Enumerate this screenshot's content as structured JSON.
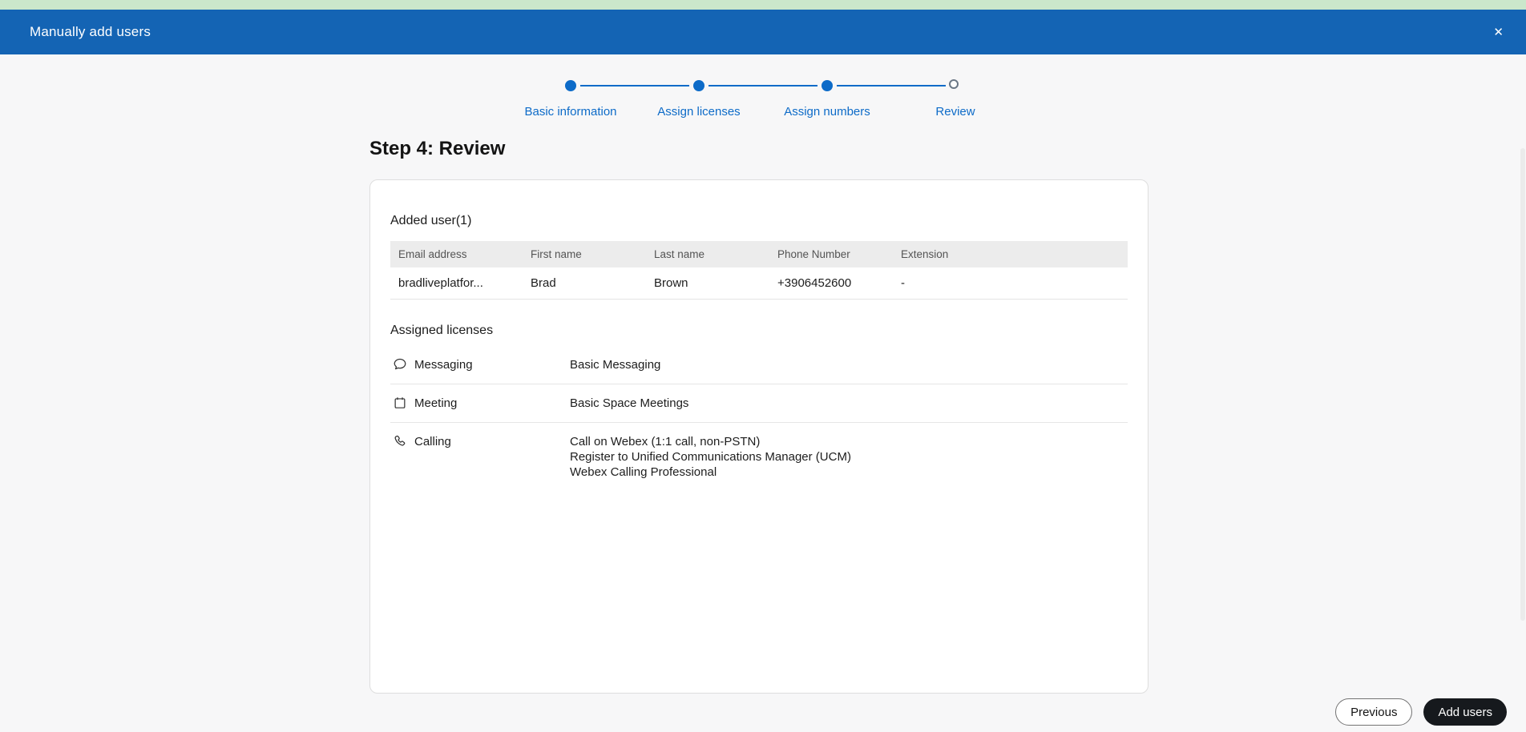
{
  "colors": {
    "strip": "#cbe7cb",
    "header_bg": "#1464b4",
    "accent": "#0d6bc8",
    "button_dark": "#16191d"
  },
  "header": {
    "title": "Manually add users",
    "close_glyph": "✕"
  },
  "stepper": {
    "steps": [
      {
        "label": "Basic information",
        "state": "complete"
      },
      {
        "label": "Assign licenses",
        "state": "complete"
      },
      {
        "label": "Assign numbers",
        "state": "complete"
      },
      {
        "label": "Review",
        "state": "current"
      }
    ]
  },
  "heading": "Step 4: Review",
  "added_user": {
    "title": "Added user(1)",
    "columns": [
      "Email address",
      "First name",
      "Last name",
      "Phone Number",
      "Extension"
    ],
    "rows": [
      [
        "bradliveplatfor...",
        "Brad",
        "Brown",
        "+3906452600",
        "-"
      ]
    ]
  },
  "licenses": {
    "title": "Assigned licenses",
    "items": [
      {
        "icon": "chat-bubble-icon",
        "label": "Messaging",
        "values": [
          "Basic Messaging"
        ]
      },
      {
        "icon": "calendar-icon",
        "label": "Meeting",
        "values": [
          "Basic Space Meetings"
        ]
      },
      {
        "icon": "phone-icon",
        "label": "Calling",
        "values": [
          "Call on Webex (1:1 call, non-PSTN)",
          "Register to Unified Communications Manager (UCM)",
          "Webex Calling Professional"
        ]
      }
    ]
  },
  "footer": {
    "previous": "Previous",
    "add_users": "Add users"
  }
}
